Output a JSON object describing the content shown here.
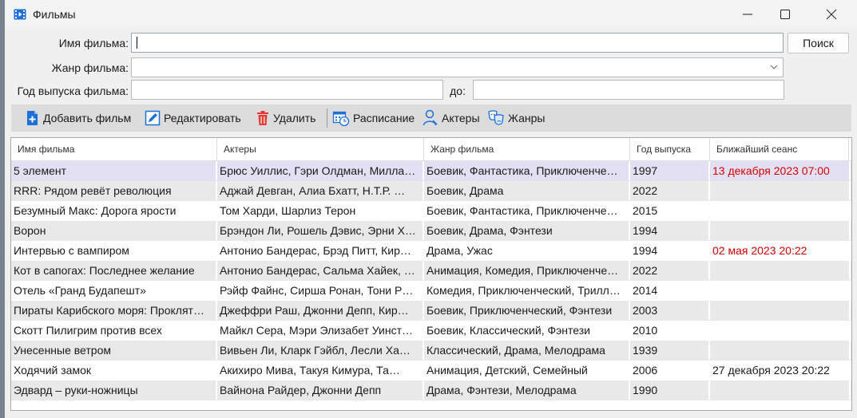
{
  "window": {
    "title": "Фильмы"
  },
  "form": {
    "name_label": "Имя фильма:",
    "name_value": "",
    "search_label": "Поиск",
    "genre_label": "Жанр фильма:",
    "genre_value": "",
    "year_label": "Год выпуска фильма:",
    "year_from_value": "",
    "to_label": "до:",
    "year_to_value": ""
  },
  "toolbar": {
    "add": "Добавить фильм",
    "edit": "Редактировать",
    "delete": "Удалить",
    "schedule": "Расписание",
    "actors": "Актеры",
    "genres": "Жанры"
  },
  "table": {
    "columns": [
      "Имя фильма",
      "Актеры",
      "Жанр фильма",
      "Год выпуска",
      "Ближайший сеанс"
    ],
    "rows": [
      {
        "name": "5 элемент",
        "actors": "Брюс Уиллис, Гэри Олдман, Милла…",
        "genre": "Боевик, Фантастика, Приключенче…",
        "year": "1997",
        "session": "13 декабря 2023 07:00",
        "session_red": true,
        "selected": true
      },
      {
        "name": "RRR: Рядом ревёт революция",
        "actors": "Аджай Девган, Алиа Бхатт, Н.Т.Р. …",
        "genre": "Боевик, Драма",
        "year": "2022",
        "session": "",
        "session_red": false
      },
      {
        "name": "Безумный Макс: Дорога ярости",
        "actors": "Том Харди, Шарлиз Терон",
        "genre": "Боевик, Фантастика, Приключенче…",
        "year": "2015",
        "session": "",
        "session_red": false
      },
      {
        "name": "Ворон",
        "actors": "Брэндон Ли, Рошель Дэвис, Эрни Х…",
        "genre": "Боевик, Драма, Фэнтези",
        "year": "1994",
        "session": "",
        "session_red": false
      },
      {
        "name": "Интервью с вампиром",
        "actors": "Антонио Бандерас, Брэд Питт, Кир…",
        "genre": "Драма, Ужас",
        "year": "1994",
        "session": "02 мая 2023 20:22",
        "session_red": true
      },
      {
        "name": "Кот в сапогах: Последнее желание",
        "actors": "Антонио Бандерас, Сальма Хайек, …",
        "genre": "Анимация, Комедия, Приключенче…",
        "year": "2022",
        "session": "",
        "session_red": false
      },
      {
        "name": "Отель «Гранд Будапешт»",
        "actors": "Рэйф Файнс, Сирша Ронан, Тони Р…",
        "genre": "Комедия, Приключенческий, Трилл…",
        "year": "2014",
        "session": "",
        "session_red": false
      },
      {
        "name": "Пираты Карибского моря: Проклят…",
        "actors": "Джеффри Раш, Джонни Депп, Кир…",
        "genre": "Боевик, Приключенческий, Фэнтези",
        "year": "2003",
        "session": "",
        "session_red": false
      },
      {
        "name": "Скотт Пилигрим против всех",
        "actors": "Майкл Сера, Мэри Элизабет Уинст…",
        "genre": "Боевик, Классический, Фэнтези",
        "year": "2010",
        "session": "",
        "session_red": false
      },
      {
        "name": "Унесенные ветром",
        "actors": "Вивьен Ли, Кларк Гэйбл, Лесли Ха…",
        "genre": "Классический, Драма, Мелодрама",
        "year": "1939",
        "session": "",
        "session_red": false
      },
      {
        "name": "Ходячий замок",
        "actors": "Акихиро Мива, Такуя  Кимура, Та…",
        "genre": "Анимация, Детский, Семейный",
        "year": "2006",
        "session": "27 декабря 2023 20:22",
        "session_red": false
      },
      {
        "name": "Эдвард – руки-ножницы",
        "actors": "Вайнона Райдер, Джонни Депп",
        "genre": "Драма, Фэнтези, Мелодрама",
        "year": "1990",
        "session": "",
        "session_red": false
      }
    ]
  },
  "colors": {
    "accent": "#1e6fd9",
    "selected_row": "#e4e0f4",
    "alt_row": "#e9e9e9",
    "session_red": "#d40000",
    "toolbar_bg": "#dcdcdc"
  }
}
